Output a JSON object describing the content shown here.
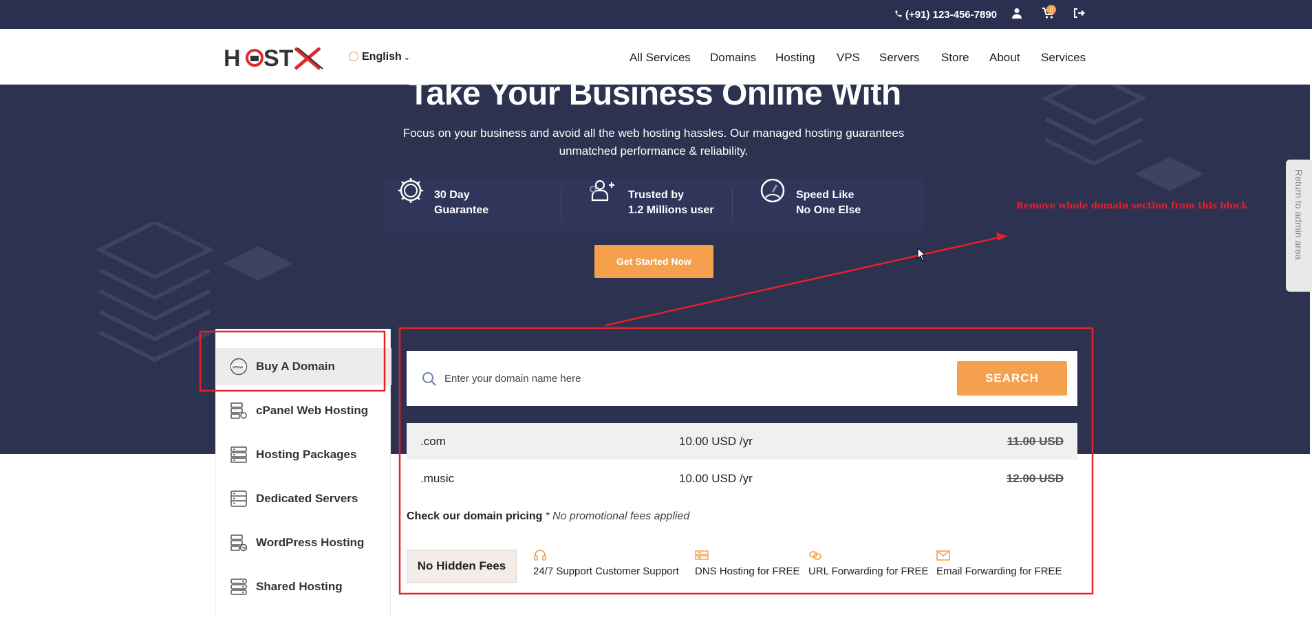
{
  "topbar": {
    "phone": "(+91) 123-456-7890",
    "icons": [
      "phone-icon",
      "user-icon",
      "cart-icon",
      "logout-icon"
    ],
    "cart_count": "0"
  },
  "nav": {
    "logo_text": "HOSTX",
    "language": "English",
    "items": [
      "All Services",
      "Domains",
      "Hosting",
      "VPS",
      "Servers",
      "Store",
      "About",
      "Services"
    ]
  },
  "hero": {
    "title": "Take Your Business Online With",
    "subtitle": "Focus on your business and avoid all the web hosting hassles. Our managed hosting guarantees unmatched performance & reliability.",
    "features": [
      {
        "line1": "30 Day",
        "line2": "Guarantee",
        "icon": "badge-icon"
      },
      {
        "line1": "Trusted by",
        "line2": "1.2 Millions user",
        "icon": "users-icon"
      },
      {
        "line1": "Speed Like",
        "line2": "No One Else",
        "icon": "speed-icon"
      }
    ],
    "cta": "Get Started Now"
  },
  "return_admin": "Return to admin area",
  "annotation": "Remove whole domain section from this block",
  "sidebar": {
    "items": [
      {
        "label": "Buy A Domain",
        "icon": "www-icon",
        "active": true
      },
      {
        "label": "cPanel Web Hosting",
        "icon": "server-settings-icon"
      },
      {
        "label": "Hosting Packages",
        "icon": "server-stack-icon"
      },
      {
        "label": "Dedicated Servers",
        "icon": "server-rack-icon"
      },
      {
        "label": "WordPress Hosting",
        "icon": "wordpress-server-icon"
      },
      {
        "label": "Shared Hosting",
        "icon": "shared-server-icon"
      }
    ]
  },
  "domain": {
    "search_placeholder": "Enter your domain name here",
    "search_button": "SEARCH",
    "prices": [
      {
        "tld": ".com",
        "price": "10.00 USD /yr",
        "old": "11.00 USD"
      },
      {
        "tld": ".music",
        "price": "10.00 USD /yr",
        "old": "12.00 USD"
      }
    ],
    "note_bold": "Check our domain pricing",
    "note_italic": "* No promotional fees applied",
    "no_hidden": "No Hidden Fees",
    "perks": [
      {
        "label": "24/7 Support Customer Support",
        "icon": "headset-icon"
      },
      {
        "label": "DNS Hosting for FREE",
        "icon": "dns-icon"
      },
      {
        "label": "URL Forwarding for FREE",
        "icon": "link-icon"
      },
      {
        "label": "Email Forwarding for FREE",
        "icon": "mail-icon"
      }
    ]
  },
  "colors": {
    "dark": "#2d3250",
    "accent": "#f5a04d",
    "annotation": "#e8202a"
  }
}
